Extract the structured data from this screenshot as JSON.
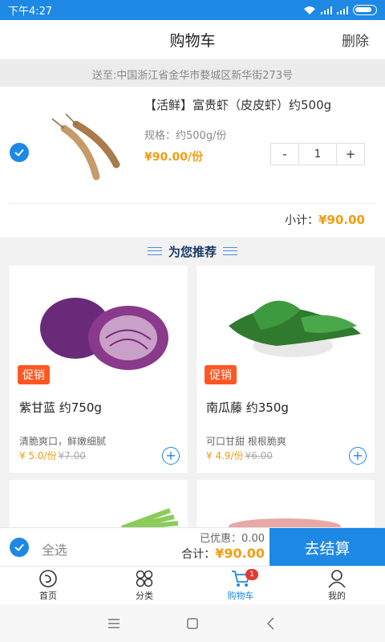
{
  "status_bar": {
    "time": "下午4:27"
  },
  "header": {
    "title": "购物车",
    "delete_label": "删除"
  },
  "address": "送至:中国浙江省金华市婺城区新华街273号",
  "cart_item": {
    "name": "【活鲜】富贵虾（皮皮虾）约500g",
    "spec": "规格：约500g/份",
    "price": "¥90.00/份",
    "minus": "-",
    "quantity": "1",
    "plus": "+",
    "subtotal_label": "小计：",
    "subtotal_amount": "¥90.00",
    "checked": true
  },
  "recommend": {
    "title": "为您推荐",
    "products": [
      {
        "promo": "促销",
        "name": "紫甘蓝  约750g",
        "desc": "清脆爽口，鲜嫩细腻",
        "price": "¥ 5.0/份",
        "old_price": "¥7.00"
      },
      {
        "promo": "促销",
        "name": "南瓜藤 约350g",
        "desc": "可口甘甜 根根脆爽",
        "price": "¥ 4.9/份",
        "old_price": "¥6.00"
      }
    ]
  },
  "bottom": {
    "select_all": "全选",
    "discount": "已优惠：0.00",
    "total_label": "合计：",
    "total_amount": "¥90.00",
    "checkout": "去结算"
  },
  "tabs": [
    {
      "label": "首页",
      "icon": "home-shrimp-icon"
    },
    {
      "label": "分类",
      "icon": "category-icon"
    },
    {
      "label": "购物车",
      "icon": "cart-icon",
      "badge": "1",
      "active": true
    },
    {
      "label": "我的",
      "icon": "user-icon"
    }
  ],
  "colors": {
    "primary": "#1e88e5",
    "price": "#f39c12",
    "promo": "#ff5722"
  }
}
